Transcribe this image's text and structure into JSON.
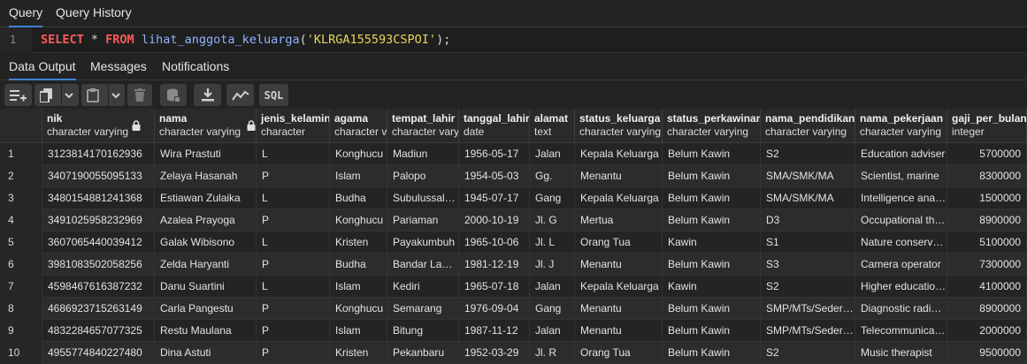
{
  "query_tabs": [
    "Query",
    "Query History"
  ],
  "editor": {
    "line_number": "1",
    "tokens": {
      "select": "SELECT",
      "star": " * ",
      "from": "FROM",
      "fn": " lihat_anggota_keluarga",
      "open": "(",
      "arg": "'KLRGA155593CSPOI'",
      "close": ");"
    }
  },
  "output_tabs": [
    "Data Output",
    "Messages",
    "Notifications"
  ],
  "toolbar": {
    "buttons": [
      "add-row-icon",
      "copy-icon",
      "chevron-down-icon",
      "paste-icon",
      "chevron-down-icon",
      "delete-icon",
      "save-data-icon",
      "download-icon",
      "graph-icon",
      "sql-icon"
    ],
    "sql_label": "SQL"
  },
  "columns": [
    {
      "name": "nik",
      "type": "character varying",
      "locked": true
    },
    {
      "name": "nama",
      "type": "character varying",
      "locked": true
    },
    {
      "name": "jenis_kelamin",
      "type": "character"
    },
    {
      "name": "agama",
      "type": "character varying"
    },
    {
      "name": "tempat_lahir",
      "type": "character varying"
    },
    {
      "name": "tanggal_lahir",
      "type": "date"
    },
    {
      "name": "alamat",
      "type": "text"
    },
    {
      "name": "status_keluarga",
      "type": "character varying"
    },
    {
      "name": "status_perkawinan",
      "type": "character varying"
    },
    {
      "name": "nama_pendidikan",
      "type": "character varying"
    },
    {
      "name": "nama_pekerjaan",
      "type": "character varying"
    },
    {
      "name": "gaji_per_bulan",
      "type": "integer"
    }
  ],
  "rows": [
    [
      "1",
      "3123814170162936",
      "Wira Prastuti",
      "L",
      "Konghucu",
      "Madiun",
      "1956-05-17",
      "Jalan",
      "Kepala Keluarga",
      "Belum Kawin",
      "S2",
      "Education adviser",
      "5700000"
    ],
    [
      "2",
      "3407190055095133",
      "Zelaya Hasanah",
      "P",
      "Islam",
      "Palopo",
      "1954-05-03",
      "Gg.",
      "Menantu",
      "Belum Kawin",
      "SMA/SMK/MA",
      "Scientist, marine",
      "8300000"
    ],
    [
      "3",
      "3480154881241368",
      "Estiawan Zulaika",
      "L",
      "Budha",
      "Subulussalam",
      "1945-07-17",
      "Gang",
      "Kepala Keluarga",
      "Belum Kawin",
      "SMA/SMK/MA",
      "Intelligence analyst",
      "1500000"
    ],
    [
      "4",
      "3491025958232969",
      "Azalea Prayoga",
      "P",
      "Konghucu",
      "Pariaman",
      "2000-10-19",
      "Jl. G",
      "Mertua",
      "Belum Kawin",
      "D3",
      "Occupational therapist",
      "8900000"
    ],
    [
      "5",
      "3607065440039412",
      "Galak Wibisono",
      "L",
      "Kristen",
      "Payakumbuh",
      "1965-10-06",
      "Jl. L",
      "Orang Tua",
      "Kawin",
      "S1",
      "Nature conservation officer",
      "5100000"
    ],
    [
      "6",
      "3981083502058256",
      "Zelda Haryanti",
      "P",
      "Budha",
      "Bandar Lampung",
      "1981-12-19",
      "Jl. J",
      "Menantu",
      "Belum Kawin",
      "S3",
      "Camera operator",
      "7300000"
    ],
    [
      "7",
      "4598467616387232",
      "Danu Suartini",
      "L",
      "Islam",
      "Kediri",
      "1965-07-18",
      "Jalan",
      "Kepala Keluarga",
      "Kawin",
      "S2",
      "Higher education lecturer",
      "4100000"
    ],
    [
      "8",
      "4686923715263149",
      "Carla Pangestu",
      "P",
      "Konghucu",
      "Semarang",
      "1976-09-04",
      "Gang",
      "Menantu",
      "Belum Kawin",
      "SMP/MTs/Sederajat",
      "Diagnostic radiographer",
      "8900000"
    ],
    [
      "9",
      "4832284657077325",
      "Restu Maulana",
      "P",
      "Islam",
      "Bitung",
      "1987-11-12",
      "Jalan",
      "Menantu",
      "Belum Kawin",
      "SMP/MTs/Sederajat",
      "Telecommunications researcher",
      "2000000"
    ],
    [
      "10",
      "4955774840227480",
      "Dina Astuti",
      "P",
      "Kristen",
      "Pekanbaru",
      "1952-03-29",
      "Jl. R",
      "Orang Tua",
      "Belum Kawin",
      "S2",
      "Music therapist",
      "9500000"
    ]
  ]
}
